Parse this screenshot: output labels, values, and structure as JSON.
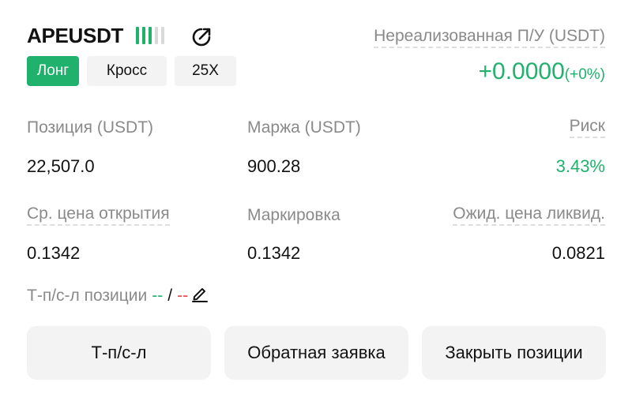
{
  "header": {
    "symbol": "APEUSDT",
    "long_badge": "Лонг",
    "margin_mode": "Кросс",
    "leverage": "25X",
    "pnl_label": "Нереализованная П/У (USDT)",
    "pnl_value": "+0.0000",
    "pnl_percent": "(+0%)",
    "leverage_bars_active": 3,
    "leverage_bars_total": 5,
    "icons": [
      "share-icon",
      "edit-icon"
    ]
  },
  "stats": {
    "position_label": "Позиция (USDT)",
    "position_value": "22,507.0",
    "margin_label": "Маржа (USDT)",
    "margin_value": "900.28",
    "risk_label": "Риск",
    "risk_value": "3.43%",
    "entry_label": "Ср. цена открытия",
    "entry_value": "0.1342",
    "mark_label": "Маркировка",
    "mark_value": "0.1342",
    "liq_label": "Ожид. цена ликвид.",
    "liq_value": "0.0821"
  },
  "tpsl": {
    "label": "Т-п/с-л позиции",
    "tp": "--",
    "slash": "/",
    "sl": "--"
  },
  "buttons": {
    "tpsl": "Т-п/с-л",
    "reverse": "Обратная заявка",
    "close": "Закрыть позиции"
  },
  "colors": {
    "green": "#20b26c",
    "red": "#ef454a",
    "muted": "#8a8a8a",
    "button_bg": "#f3f3f3"
  }
}
